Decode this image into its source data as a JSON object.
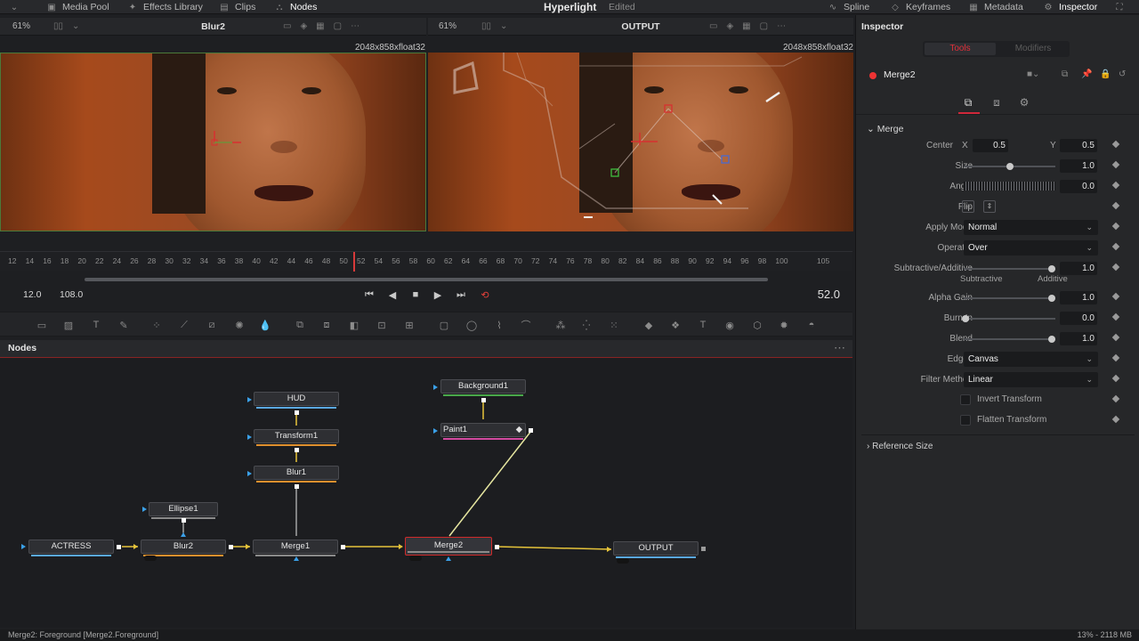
{
  "topbar": {
    "media_pool": "Media Pool",
    "effects_library": "Effects Library",
    "clips": "Clips",
    "nodes": "Nodes",
    "app_title": "Hyperlight",
    "app_status": "Edited",
    "spline": "Spline",
    "keyframes": "Keyframes",
    "metadata": "Metadata",
    "inspector": "Inspector"
  },
  "viewer_left": {
    "zoom": "61%",
    "title": "Blur2",
    "resolution": "2048x858xfloat32"
  },
  "viewer_right": {
    "zoom": "61%",
    "title": "OUTPUT",
    "resolution": "2048x858xfloat32"
  },
  "timeline": {
    "ticks": [
      "12",
      "14",
      "16",
      "18",
      "20",
      "22",
      "24",
      "26",
      "28",
      "30",
      "32",
      "34",
      "36",
      "38",
      "40",
      "42",
      "44",
      "46",
      "48",
      "50",
      "52",
      "54",
      "56",
      "58",
      "60",
      "62",
      "64",
      "66",
      "68",
      "70",
      "72",
      "74",
      "76",
      "78",
      "80",
      "82",
      "84",
      "86",
      "88",
      "90",
      "92",
      "94",
      "96",
      "98",
      "100",
      "105"
    ],
    "playhead_frame": 52
  },
  "transport": {
    "start": "12.0",
    "end": "108.0",
    "current": "52.0"
  },
  "nodes_panel": {
    "title": "Nodes",
    "nodes": {
      "actress": "ACTRESS",
      "blur2": "Blur2",
      "merge1": "Merge1",
      "merge2": "Merge2",
      "output": "OUTPUT",
      "ellipse1": "Ellipse1",
      "hud": "HUD",
      "transform1": "Transform1",
      "blur1": "Blur1",
      "background1": "Background1",
      "paint1": "Paint1"
    }
  },
  "status": {
    "left": "Merge2: Foreground   [Merge2.Foreground]",
    "right": "13% - 2118 MB"
  },
  "inspector": {
    "title": "Inspector",
    "tab_tools": "Tools",
    "tab_modifiers": "Modifiers",
    "tool_name": "Merge2",
    "section": "Merge",
    "center_label": "Center",
    "center_x_label": "X",
    "center_x": "0.5",
    "center_y_label": "Y",
    "center_y": "0.5",
    "size_label": "Size",
    "size": "1.0",
    "angle_label": "Angle",
    "angle": "0.0",
    "flip_label": "Flip",
    "apply_mode_label": "Apply Mode",
    "apply_mode": "Normal",
    "operator_label": "Operator",
    "operator": "Over",
    "sub_add_label": "Subtractive/Additive",
    "sub_add": "1.0",
    "subtractive": "Subtractive",
    "additive": "Additive",
    "alpha_gain_label": "Alpha Gain",
    "alpha_gain": "1.0",
    "burn_in_label": "Burn In",
    "burn_in": "0.0",
    "blend_label": "Blend",
    "blend": "1.0",
    "edges_label": "Edges",
    "edges": "Canvas",
    "filter_method_label": "Filter Method",
    "filter_method": "Linear",
    "invert_transform": "Invert Transform",
    "flatten_transform": "Flatten Transform",
    "reference_size": "Reference Size"
  },
  "colors": {
    "accent_red": "#d0283a",
    "selection_green": "#4b7a3a",
    "wire_yellow": "#e6c43a",
    "port_blue": "#3aa0e8"
  }
}
